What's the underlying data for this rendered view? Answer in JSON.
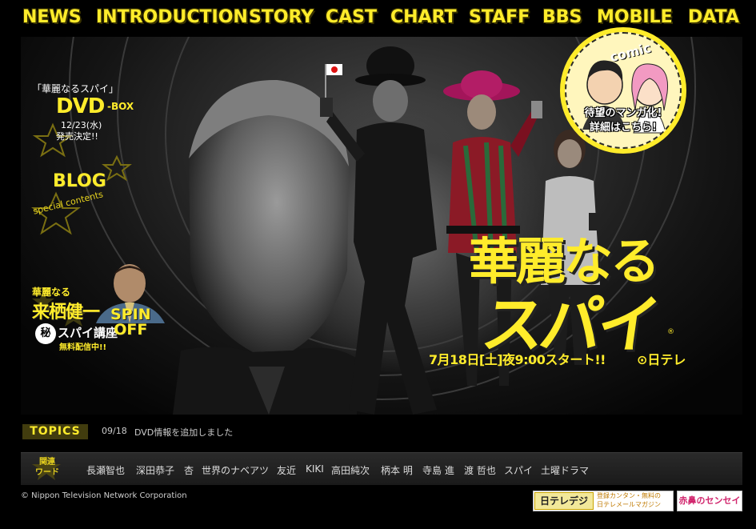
{
  "nav": {
    "items": [
      "NEWS",
      "INTRODUCTION",
      "STORY",
      "CAST",
      "CHART",
      "STAFF",
      "BBS",
      "MOBILE",
      "DATA"
    ]
  },
  "hero": {
    "dvd": {
      "title": "「華麗なるスパイ」",
      "main": "DVD",
      "suffix": "-BOX",
      "date": "12/23(水)",
      "note": "発売決定!!"
    },
    "blog": "BLOG",
    "special": "special contents",
    "spinoff": {
      "kicker": "華麗なる",
      "name": "来栖健一",
      "secret": "秘",
      "course": "スパイ講座",
      "free": "無料配信中!!",
      "spin": "SPIN",
      "off": "OFF"
    },
    "comic": {
      "label": "comic",
      "line1": "待望のマンガ化!",
      "line2": "詳細はこちら!"
    },
    "logo": {
      "line1": "華麗なる",
      "line2": "スパイ",
      "reg": "®"
    },
    "onair": "7月18日[土]夜9:00スタート!!",
    "network": "日テレ"
  },
  "topics": {
    "label": "TOPICS",
    "date": "09/18",
    "text": "DVD情報を追加しました"
  },
  "keywords": {
    "label_l1": "関連",
    "label_l2": "ワード",
    "items": [
      "長瀬智也",
      "深田恭子",
      "杏",
      "世界のナベアツ",
      "友近",
      "KIKI",
      "高田純次",
      "柄本 明",
      "寺島 進",
      "渡 哲也",
      "スパイ",
      "土曜ドラマ"
    ]
  },
  "footer": {
    "copyright": "© Nippon Television Network Corporation",
    "banner1_a": "日テレデジ",
    "banner1_b1": "登録カンタン・無料の",
    "banner1_b2": "日テレメールマガジン",
    "banner2": "赤鼻のセンセイ"
  },
  "colors": {
    "accent": "#ffec2b",
    "background": "#000000"
  }
}
